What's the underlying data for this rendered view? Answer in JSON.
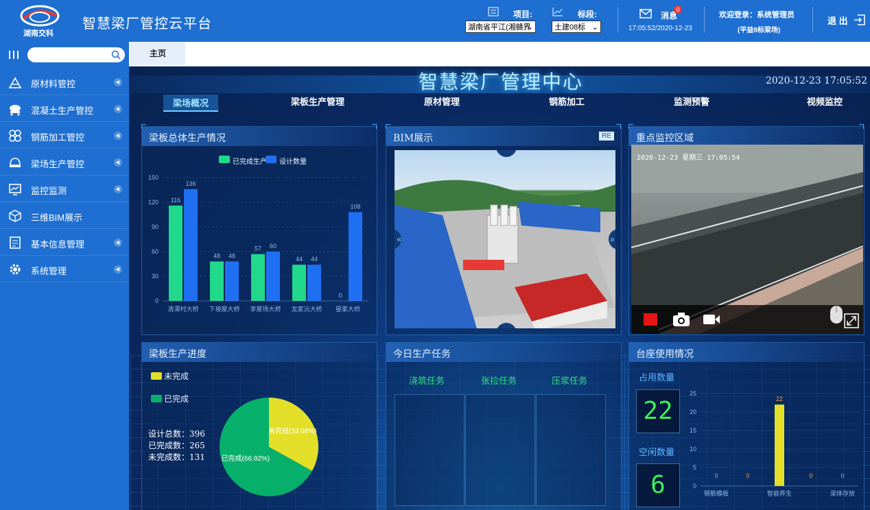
{
  "app": {
    "logo_text": "湖南交科",
    "title": "智慧梁厂管控云平台"
  },
  "topbar": {
    "project_label": "项目:",
    "project_value": "湖南省平江(湘赣界",
    "section_label": "标段:",
    "section_value": "土建08标",
    "message_label": "消息",
    "message_badge": "0",
    "datetime": "17:05:52/2020-12-23",
    "welcome": "欢迎登录：系统管理员",
    "site": "(平益8标梁场)",
    "logout": "退 出"
  },
  "sidebar": {
    "search_placeholder": "",
    "items": [
      {
        "label": "原材料管控",
        "icon": "materials-icon"
      },
      {
        "label": "混凝土生产管控",
        "icon": "concrete-mixer-icon"
      },
      {
        "label": "钢筋加工管控",
        "icon": "rebar-icon"
      },
      {
        "label": "梁场生产管控",
        "icon": "helmet-icon"
      },
      {
        "label": "监控监测",
        "icon": "monitor-chart-icon"
      },
      {
        "label": "三维BIM展示",
        "icon": "cube-3d-icon"
      },
      {
        "label": "基本信息管理",
        "icon": "info-list-icon"
      },
      {
        "label": "系统管理",
        "icon": "gear-icon"
      }
    ]
  },
  "tabs": [
    {
      "label": "主页"
    }
  ],
  "dashboard": {
    "title": "智慧梁厂管理中心",
    "time": "2020-12-23 17:05:52",
    "nav": [
      "梁场概况",
      "梁板生产管理",
      "原材管理",
      "钢筋加工",
      "监测预警",
      "视频监控"
    ],
    "panels": {
      "production": "梁板总体生产情况",
      "bim": "BIM展示",
      "bim_badge": "RE",
      "monitor": "重点监控区域",
      "progress": "梁板生产进度",
      "tasks": "今日生产任务",
      "pedestal": "台座使用情况"
    },
    "camera_osd": "2020-12-23 星期三 17:05:54",
    "progress_summary": {
      "designed_total": "设计总数：396",
      "completed": "已完成数：265",
      "remaining": "未完成数：131"
    },
    "tasks": [
      "浇筑任务",
      "张拉任务",
      "压浆任务"
    ],
    "pedestal_stats": {
      "occupied_label": "占用数量",
      "occupied_value": "22",
      "idle_label": "空闲数量",
      "idle_value": "6"
    }
  },
  "chart_data": [
    {
      "type": "bar",
      "categories": [
        "清潭村大桥",
        "下坡屋大桥",
        "李屋场大桥",
        "龙家沅大桥",
        "晏家大桥"
      ],
      "series": [
        {
          "name": "已完成生产",
          "values": [
            116,
            48,
            57,
            44,
            0
          ],
          "color": "#20d98a"
        },
        {
          "name": "设计数量",
          "values": [
            136,
            48,
            60,
            44,
            108
          ],
          "color": "#1f6ff2"
        }
      ],
      "ylim": [
        0,
        150
      ],
      "yticks": [
        0,
        30,
        60,
        90,
        120,
        150
      ],
      "legend": "top"
    },
    {
      "type": "pie",
      "slices": [
        {
          "name": "未完成",
          "value": 33.08,
          "label": "未完成(33.08%)",
          "color": "#e3df28"
        },
        {
          "name": "已完成",
          "value": 66.92,
          "label": "已完成(66.92%)",
          "color": "#06b06a"
        }
      ],
      "legend": "top-left"
    },
    {
      "type": "bar",
      "categories": [
        "钢筋模板",
        "",
        "智能养生",
        "",
        "梁体存放"
      ],
      "values": [
        0,
        0,
        22,
        0,
        0
      ],
      "ylim": [
        0,
        25
      ],
      "yticks": [
        0,
        5,
        10,
        15,
        20,
        25
      ],
      "color": "#e3df28"
    }
  ]
}
